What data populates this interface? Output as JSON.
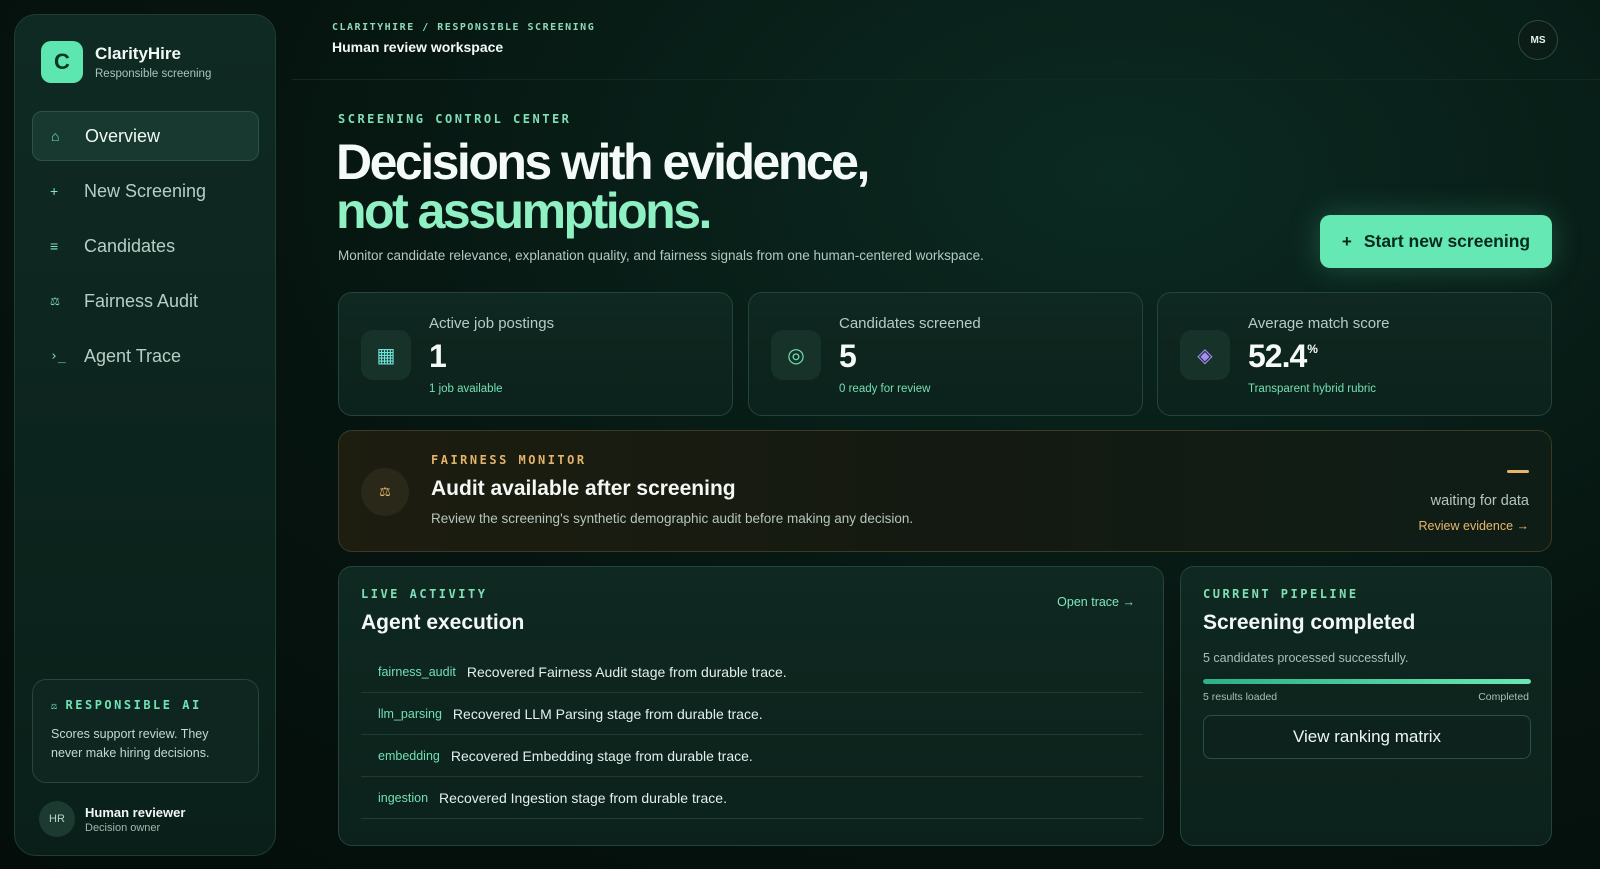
{
  "brand": {
    "logo": "C",
    "name": "ClarityHire",
    "subtitle": "Responsible screening"
  },
  "sidebar": {
    "items": [
      {
        "label": "Overview",
        "icon": "home-icon",
        "glyph": "⌂",
        "active": true
      },
      {
        "label": "New Screening",
        "icon": "plus-icon",
        "glyph": "+"
      },
      {
        "label": "Candidates",
        "icon": "list-icon",
        "glyph": "≡"
      },
      {
        "label": "Fairness Audit",
        "icon": "scale-icon",
        "glyph": "⚖"
      },
      {
        "label": "Agent Trace",
        "icon": "terminal-icon",
        "glyph": "›_"
      }
    ],
    "responsible_ai": {
      "title": "RESPONSIBLE AI",
      "text": "Scores support review. They never make hiring decisions."
    },
    "user": {
      "initials": "HR",
      "name": "Human reviewer",
      "role": "Decision owner"
    }
  },
  "header": {
    "breadcrumb": "CLARITYHIRE / RESPONSIBLE SCREENING",
    "title": "Human review workspace",
    "avatar": "MS"
  },
  "hero": {
    "eyebrow": "SCREENING CONTROL CENTER",
    "line1": "Decisions with evidence,",
    "line2": "not assumptions.",
    "description": "Monitor candidate relevance, explanation quality, and fairness signals from one human-centered workspace.",
    "cta": "Start new screening",
    "cta_icon": "+"
  },
  "stats": [
    {
      "label": "Active job postings",
      "value": "1",
      "unit": "",
      "sub": "1 job available",
      "icon": "grid-icon",
      "glyph": "▦",
      "color": "#6fe3d8"
    },
    {
      "label": "Candidates screened",
      "value": "5",
      "unit": "",
      "sub": "0 ready for review",
      "icon": "target-icon",
      "glyph": "◎",
      "color": "#6fe3b5"
    },
    {
      "label": "Average match score",
      "value": "52.4",
      "unit": "%",
      "sub": "Transparent hybrid rubric",
      "icon": "diamond-icon",
      "glyph": "◈",
      "color": "#a78bfa"
    }
  ],
  "fairness": {
    "eyebrow": "FAIRNESS MONITOR",
    "title": "Audit available after screening",
    "description": "Review the screening's synthetic demographic audit before making any decision.",
    "status": "waiting for data",
    "link": "Review evidence →",
    "icon_glyph": "⚖"
  },
  "activity": {
    "eyebrow": "LIVE ACTIVITY",
    "title": "Agent execution",
    "open_trace": "Open trace →",
    "rows": [
      {
        "tag": "fairness_audit",
        "text": "Recovered Fairness Audit stage from durable trace."
      },
      {
        "tag": "llm_parsing",
        "text": "Recovered LLM Parsing stage from durable trace."
      },
      {
        "tag": "embedding",
        "text": "Recovered Embedding stage from durable trace."
      },
      {
        "tag": "ingestion",
        "text": "Recovered Ingestion stage from durable trace."
      }
    ]
  },
  "pipeline": {
    "eyebrow": "CURRENT PIPELINE",
    "title": "Screening completed",
    "subtitle": "5 candidates processed successfully.",
    "progress": 1.0,
    "left_label": "5 results loaded",
    "right_label": "Completed",
    "button": "View ranking matrix"
  },
  "colors": {
    "accent": "#66e8b4",
    "warning": "#e6b76b",
    "background": "#06140f"
  }
}
